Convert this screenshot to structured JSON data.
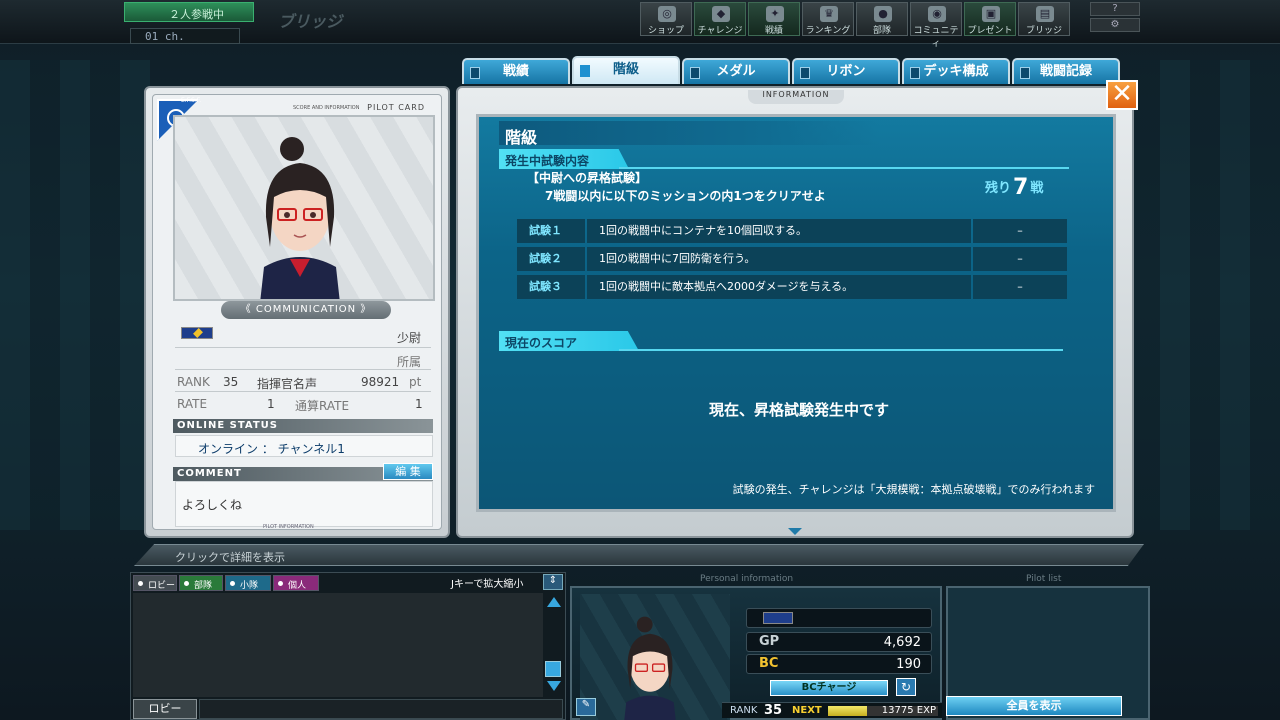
{
  "top": {
    "status": "２人参戦中",
    "channel": "01 ch.",
    "area": "ブリッジ",
    "nav": [
      {
        "label": "ショップ",
        "icon": "shop-icon",
        "glyph": "◎"
      },
      {
        "label": "チャレンジ",
        "icon": "challenge-icon",
        "glyph": "◆"
      },
      {
        "label": "戦績",
        "icon": "record-icon",
        "glyph": "✦"
      },
      {
        "label": "ランキング",
        "icon": "ranking-icon",
        "glyph": "♛"
      },
      {
        "label": "部隊",
        "icon": "unit-icon",
        "glyph": "●"
      },
      {
        "label": "コミュニティ",
        "icon": "community-icon",
        "glyph": "◉"
      },
      {
        "label": "プレゼント",
        "icon": "present-icon",
        "glyph": "▣"
      },
      {
        "label": "ブリッジ",
        "icon": "bridge-icon",
        "glyph": "▤"
      }
    ],
    "help": "?",
    "settings": "⚙"
  },
  "tabs": [
    "戦績",
    "階級",
    "メダル",
    "リボン",
    "デッキ構成",
    "戦闘記録"
  ],
  "card": {
    "badge": "E.F.S.F.",
    "title": "PILOT CARD",
    "subtitle": "SCORE AND INFORMATION",
    "communication": "《 COMMUNICATION 》",
    "rank_name": "少尉",
    "affiliation": "所属",
    "rank_label": "RANK",
    "rank_value": "35",
    "fame_label": "指揮官名声",
    "fame_value": "98921",
    "fame_unit": "pt",
    "rate_label": "RATE",
    "rate_value": "1",
    "total_rate_label": "通算RATE",
    "total_rate_value": "1",
    "online_status_header": "ONLINE STATUS",
    "online_status": "オンライン ： チャンネル1",
    "comment_header": "COMMENT",
    "edit_button": "編 集",
    "comment": "よろしくね",
    "footer": "PILOT INFORMATION"
  },
  "panel": {
    "header": "INFORMATION",
    "title": "階級",
    "exam_section": "発生中試験内容",
    "exam_title": "【中尉への昇格試験】",
    "exam_desc": "7戦闘以内に以下のミッションの内1つをクリアせよ",
    "remain_prefix": "残り",
    "remain_value": "7",
    "remain_suffix": "戦",
    "tests": [
      {
        "name": "試験１",
        "desc": "1回の戦闘中にコンテナを10個回収する。",
        "status": "–"
      },
      {
        "name": "試験２",
        "desc": "1回の戦闘中に7回防衛を行う。",
        "status": "–"
      },
      {
        "name": "試験３",
        "desc": "1回の戦闘中に敵本拠点へ2000ダメージを与える。",
        "status": "–"
      }
    ],
    "score_section": "現在のスコア",
    "message": "現在、昇格試験発生中です",
    "note": "試験の発生、チャレンジは「大規模戦：本拠点破壊戦」でのみ行われます"
  },
  "detail_bar": "クリックで詳細を表示",
  "chat": {
    "tabs": [
      "ロビー",
      "部隊",
      "小隊",
      "個人"
    ],
    "zoom_hint": "Jキーで拡大縮小",
    "channel": "ロビー"
  },
  "personal": {
    "label": "Personal information",
    "gp_label": "GP",
    "gp_value": "4,692",
    "bc_label": "BC",
    "bc_value": "190",
    "bc_charge": "BCチャージ",
    "rank_label": "RANK",
    "rank_value": "35",
    "next_label": "NEXT",
    "exp_value": "13775 EXP",
    "exp_progress": 0.35
  },
  "pilot_list": {
    "label": "Pilot list",
    "show_all": "全員を表示"
  },
  "colors": {
    "accent": "#2ac8e8",
    "screen": "#0c6488",
    "close": "#f07a20"
  }
}
